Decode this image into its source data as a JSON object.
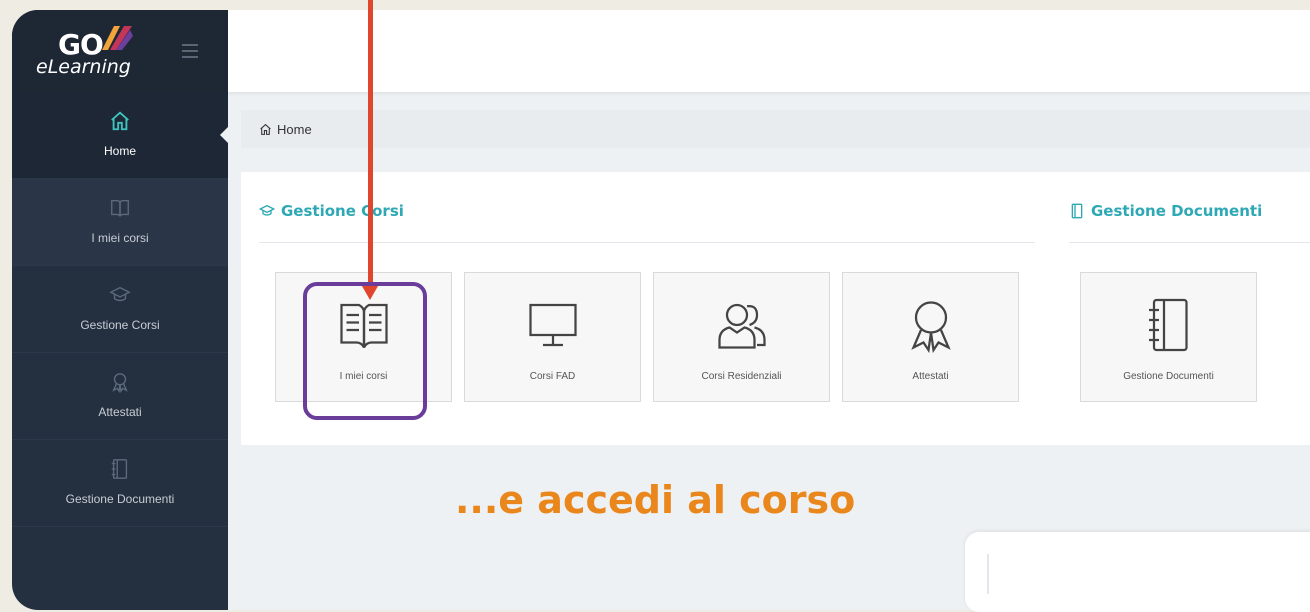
{
  "brand": {
    "logo_top": "GO",
    "logo_sub": "eLearning"
  },
  "sidebar": {
    "items": [
      {
        "label": "Home",
        "icon": "home-icon",
        "active": true
      },
      {
        "label": "I miei corsi",
        "icon": "book-icon"
      },
      {
        "label": "Gestione Corsi",
        "icon": "graduation-cap-icon"
      },
      {
        "label": "Attestati",
        "icon": "award-icon"
      },
      {
        "label": "Gestione Documenti",
        "icon": "notebook-icon"
      }
    ]
  },
  "breadcrumb": {
    "label": "Home"
  },
  "sections": {
    "corsi": {
      "title": "Gestione Corsi",
      "tiles": [
        {
          "label": "I miei corsi",
          "icon": "book-icon"
        },
        {
          "label": "Corsi FAD",
          "icon": "monitor-icon"
        },
        {
          "label": "Corsi Residenziali",
          "icon": "users-icon"
        },
        {
          "label": "Attestati",
          "icon": "award-icon"
        }
      ]
    },
    "documenti": {
      "title": "Gestione Documenti",
      "tiles": [
        {
          "label": "Gestione Documenti",
          "icon": "notebook-icon"
        }
      ]
    }
  },
  "annotation": {
    "caption": "...e accedi al corso"
  },
  "colors": {
    "accent": "#2ea8b5",
    "sidebar": "#243040",
    "arrow": "#e0452e",
    "highlight": "#6a3d9a",
    "caption": "#e9861c"
  }
}
